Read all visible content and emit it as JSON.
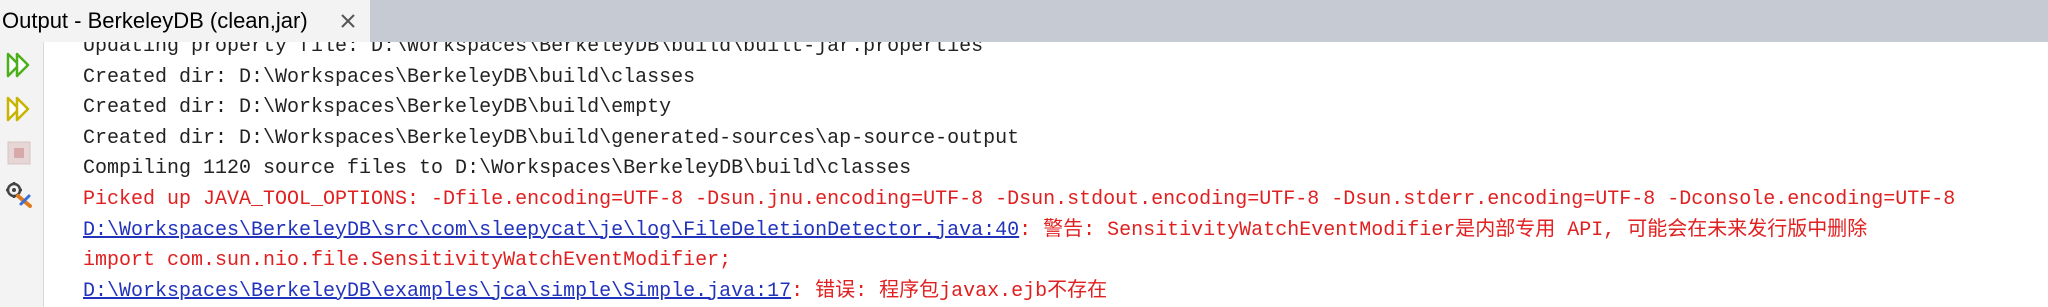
{
  "window": {
    "tab_title": "Output - BerkeleyDB (clean,jar)"
  },
  "toolbar": {
    "icons": [
      "rerun-icon",
      "rerun-with-options-icon",
      "stop-icon",
      "settings-icon"
    ]
  },
  "output": {
    "lines": [
      {
        "text": "Updating property file: D:\\Workspaces\\BerkeleyDB\\build\\built-jar.properties"
      },
      {
        "text": "Created dir: D:\\Workspaces\\BerkeleyDB\\build\\classes"
      },
      {
        "text": "Created dir: D:\\Workspaces\\BerkeleyDB\\build\\empty"
      },
      {
        "text": "Created dir: D:\\Workspaces\\BerkeleyDB\\build\\generated-sources\\ap-source-output"
      },
      {
        "text": "Compiling 1120 source files to D:\\Workspaces\\BerkeleyDB\\build\\classes"
      },
      {
        "text": "Picked up JAVA_TOOL_OPTIONS: -Dfile.encoding=UTF-8 -Dsun.jnu.encoding=UTF-8 -Dsun.stdout.encoding=UTF-8 -Dsun.stderr.encoding=UTF-8 -Dconsole.encoding=UTF-8"
      },
      {
        "link": "D:\\Workspaces\\BerkeleyDB\\src\\com\\sleepycat\\je\\log\\FileDeletionDetector.java:40",
        "message": ": 警告: SensitivityWatchEventModifier是内部专用 API, 可能会在未来发行版中删除"
      },
      {
        "text": "import com.sun.nio.file.SensitivityWatchEventModifier;"
      },
      {
        "link": "D:\\Workspaces\\BerkeleyDB\\examples\\jca\\simple\\Simple.java:17",
        "message": ": 错误: 程序包javax.ejb不存在"
      }
    ]
  },
  "colors": {
    "normal_text": "#222222",
    "error_text": "#e02020",
    "link_text": "#2233bb",
    "tab_strip": "#c6cbd3",
    "run_icon": "#4caf1a",
    "rerun_icon": "#c8b400"
  }
}
